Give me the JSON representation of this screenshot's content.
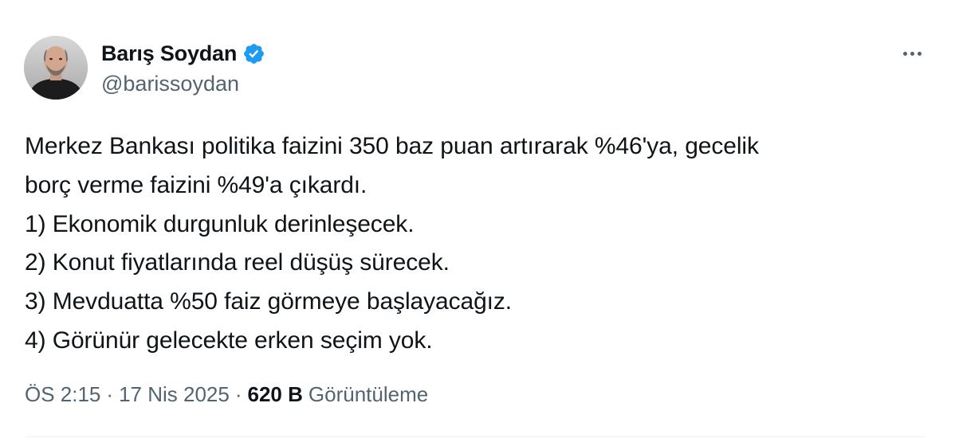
{
  "author": {
    "display_name": "Barış Soydan",
    "handle": "@barissoydan",
    "verified": true,
    "avatar_icon": "profile-photo"
  },
  "menu": {
    "more_icon": "more-horizontal-icon"
  },
  "tweet": {
    "lines": [
      "Merkez Bankası politika faizini 350 baz puan artırarak %46'ya, gecelik",
      "borç verme faizini %49'a çıkardı.",
      "1) Ekonomik durgunluk derinleşecek.",
      "2) Konut fiyatlarında reel düşüş sürecek.",
      "3) Mevduatta %50 faiz görmeye başlayacağız.",
      "4) Görünür gelecekte erken seçim yok."
    ]
  },
  "meta": {
    "time": "ÖS 2:15",
    "separator": "·",
    "date": "17 Nis 2025",
    "views_count": "620 B",
    "views_label": "Görüntüleme"
  },
  "colors": {
    "text_primary": "#0f1419",
    "text_secondary": "#536471",
    "verified_blue": "#1d9bf0",
    "divider": "#eff3f4"
  }
}
